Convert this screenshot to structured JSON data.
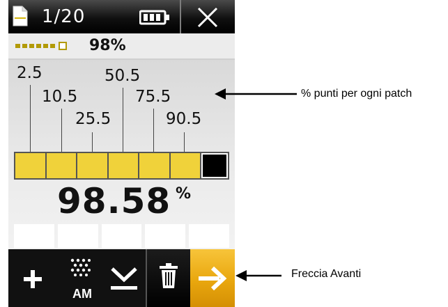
{
  "title_bar": {
    "page_counter": "1/20",
    "icons": [
      "document-icon",
      "battery-icon",
      "close-icon"
    ]
  },
  "progress": {
    "completed_dots": 6,
    "total_dots": 7,
    "percent_text": "98%"
  },
  "patches": {
    "labels": [
      "2.5",
      "10.5",
      "25.5",
      "50.5",
      "75.5",
      "90.5"
    ],
    "colors": {
      "patch_fill": "#f0d23a",
      "reference_patch": "#000000",
      "accent_orange": "#e9a70e"
    }
  },
  "measurement": {
    "value": "98.58",
    "unit": "%"
  },
  "toolbar": {
    "am_label": "AM",
    "icons": [
      "plus-icon",
      "am-screen-icon",
      "measure-icon",
      "trash-icon",
      "arrow-right-icon"
    ]
  },
  "callouts": {
    "patch_callout": "% punti per ogni patch",
    "next_callout": "Freccia Avanti"
  }
}
